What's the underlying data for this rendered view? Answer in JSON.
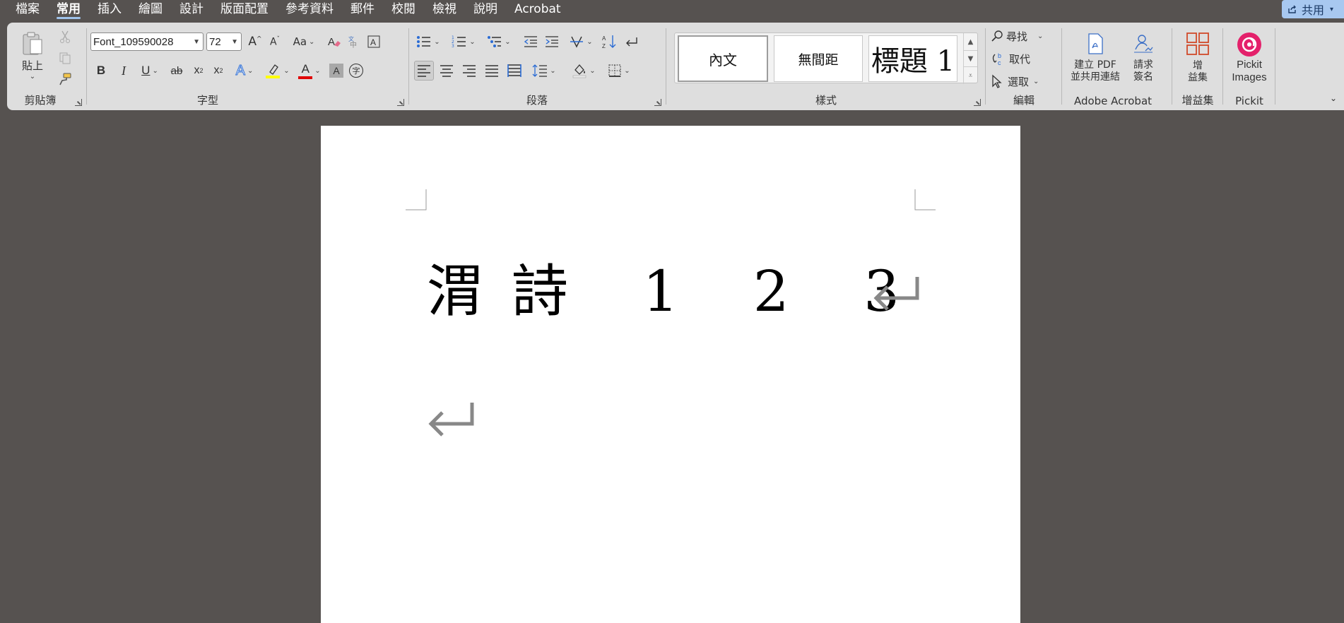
{
  "menu": {
    "items": [
      "檔案",
      "常用",
      "插入",
      "繪圖",
      "設計",
      "版面配置",
      "參考資料",
      "郵件",
      "校閱",
      "檢視",
      "說明",
      "Acrobat"
    ],
    "active_index": 1,
    "share_label": "共用"
  },
  "clipboard": {
    "paste_label": "貼上",
    "group_label": "剪貼簿"
  },
  "font": {
    "font_name": "Font_109590028",
    "font_size": "72",
    "aa_label": "Aa",
    "bold": "B",
    "italic": "I",
    "underline": "U",
    "strike": "ab",
    "subscript": "x",
    "superscript": "x",
    "subscript_2": "2",
    "superscript_2": "2",
    "text_effects": "A",
    "font_color": "A",
    "char_shading": "A",
    "enclose": "字",
    "group_label": "字型"
  },
  "paragraph": {
    "group_label": "段落"
  },
  "styles": {
    "items": [
      "內文",
      "無間距",
      "標題 1"
    ],
    "group_label": "樣式"
  },
  "editing": {
    "find": "尋找",
    "replace": "取代",
    "select": "選取",
    "group_label": "編輯"
  },
  "acrobat": {
    "create_pdf_line1": "建立 PDF",
    "create_pdf_line2": "並共用連結",
    "request_sign_line1": "請求",
    "request_sign_line2": "簽名",
    "group_label": "Adobe Acrobat"
  },
  "addins": {
    "label_line1": "增",
    "label_line2": "益集",
    "group_label": "增益集"
  },
  "pickit": {
    "label_line1": "Pickit",
    "label_line2": "Images",
    "group_label": "Pickit"
  },
  "document": {
    "line1": "渭詩 1 2 3"
  },
  "colors": {
    "accent": "#9fc2ea",
    "highlight": "#ffff00",
    "font_color": "#e00000",
    "pickit": "#e4216b",
    "addins": "#d04a2a"
  }
}
